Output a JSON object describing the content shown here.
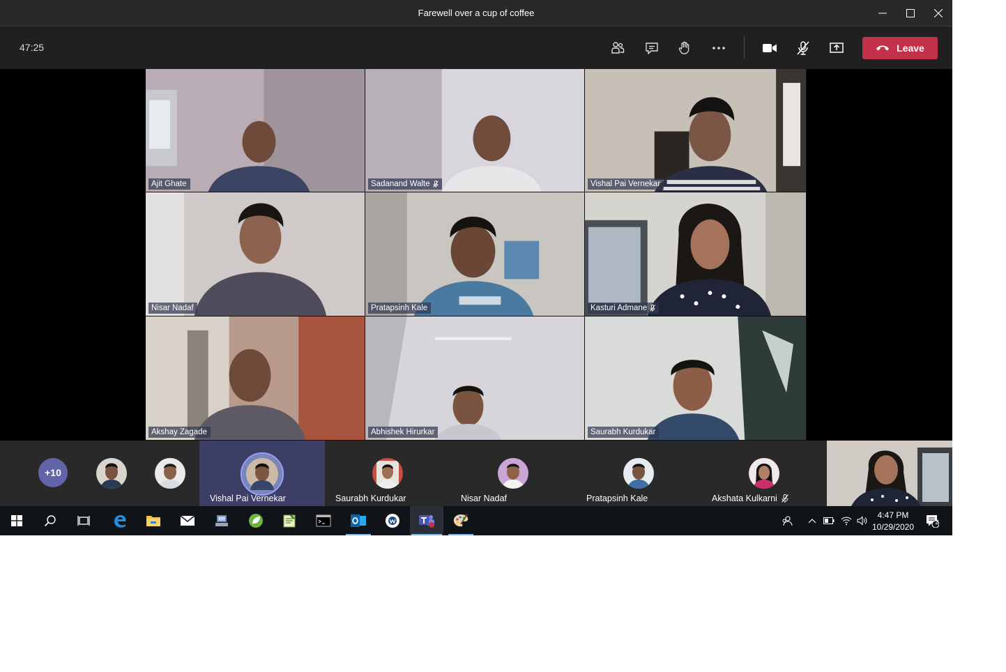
{
  "window": {
    "title": "Farewell over a cup of coffee"
  },
  "toolbar": {
    "timer": "47:25",
    "leave_label": "Leave",
    "leave_color": "#c4314b"
  },
  "video_tiles": [
    {
      "name": "Ajit Ghate",
      "muted": false
    },
    {
      "name": "Sadanand Walte",
      "muted": true
    },
    {
      "name": "Vishal Pai Vernekar",
      "muted": false
    },
    {
      "name": "Nisar Nadaf",
      "muted": false
    },
    {
      "name": "Pratapsinh Kale",
      "muted": false
    },
    {
      "name": "Kasturi Admane",
      "muted": true
    },
    {
      "name": "Akshay Zagade",
      "muted": false
    },
    {
      "name": "Abhishek Hirurkar",
      "muted": false
    },
    {
      "name": "Saurabh Kurdukar",
      "muted": false
    }
  ],
  "strip": {
    "overflow_count": "+10",
    "participants": [
      {
        "name": "Vishal Pai Vernekar",
        "speaking": true
      },
      {
        "name": "Saurabh Kurdukar",
        "speaking": false
      },
      {
        "name": "Nisar Nadaf",
        "speaking": false
      },
      {
        "name": "Pratapsinh Kale",
        "speaking": false
      },
      {
        "name": "Akshata Kulkarni",
        "speaking": false,
        "muted": true
      }
    ],
    "accent": "#6264a7"
  },
  "taskbar": {
    "time": "4:47 PM",
    "date": "10/29/2020",
    "notification_count": "2"
  }
}
